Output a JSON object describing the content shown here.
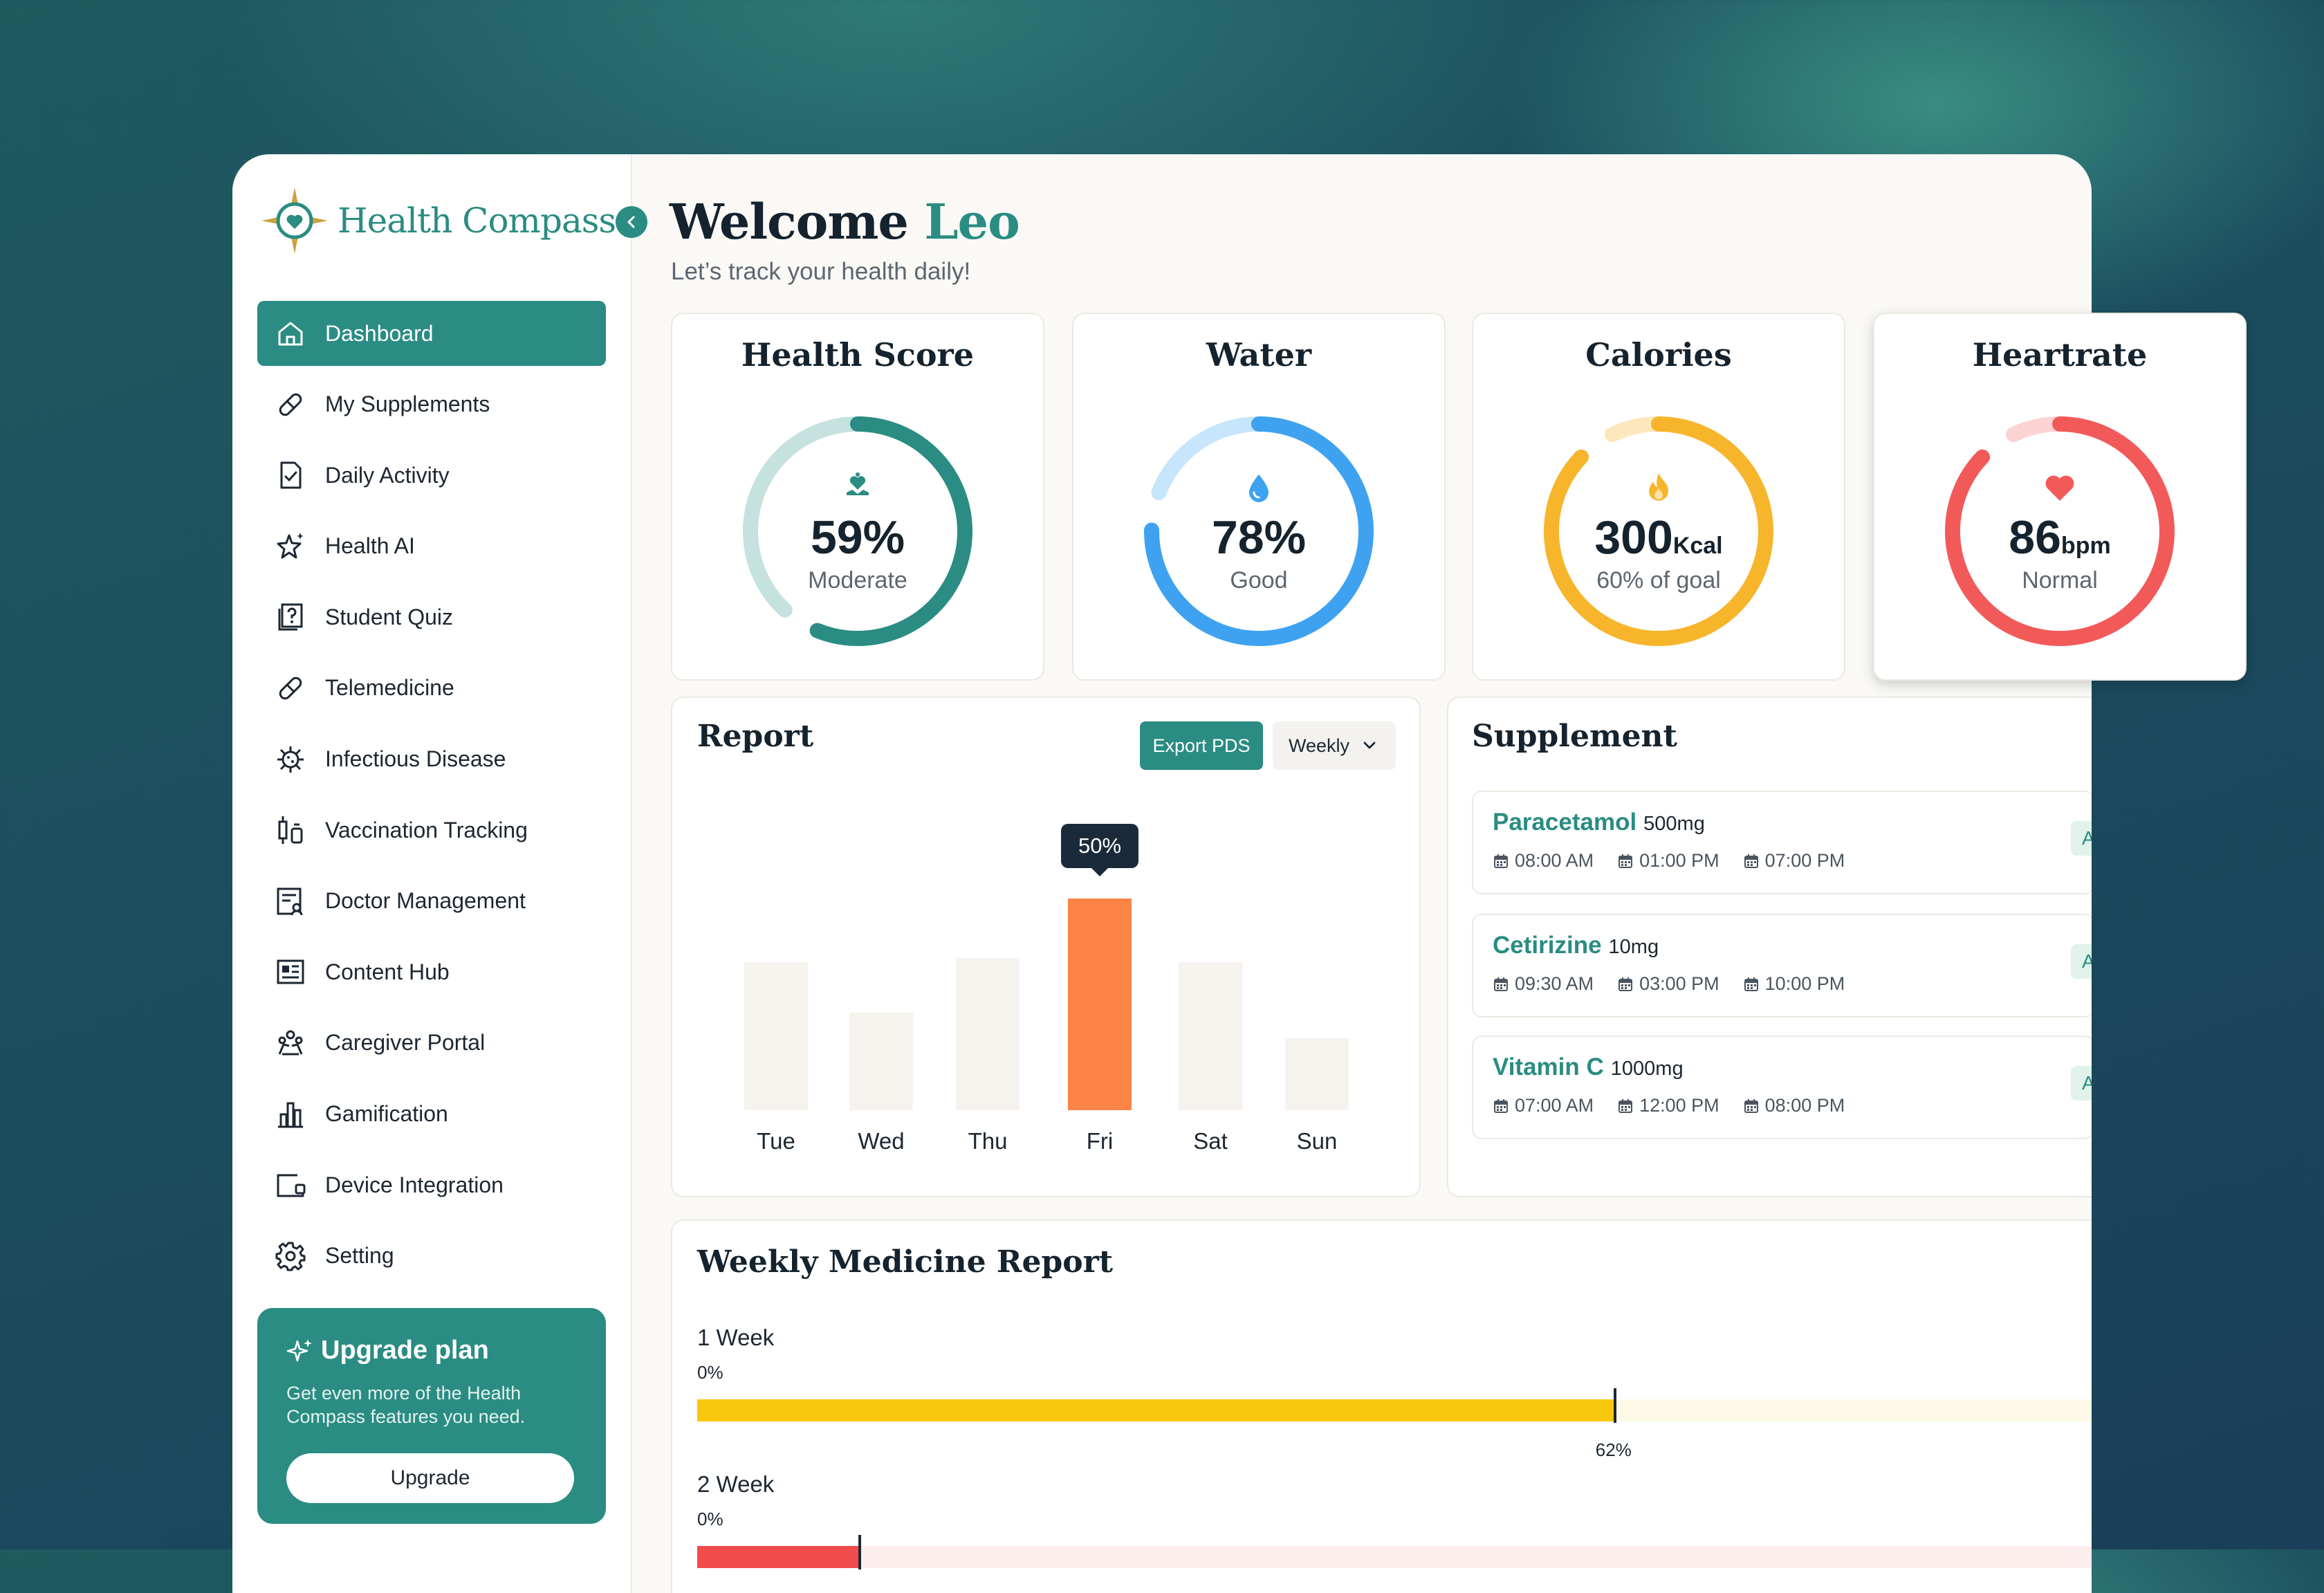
{
  "app": {
    "logo_text": "Health Compass",
    "accent_color": "#2a8c82"
  },
  "sidebar": {
    "items": [
      {
        "label": "Dashboard",
        "icon": "home-icon",
        "active": true
      },
      {
        "label": "My Supplements",
        "icon": "pill-icon"
      },
      {
        "label": "Daily Activity",
        "icon": "file-check-icon"
      },
      {
        "label": "Health AI",
        "icon": "sparkle-star-icon"
      },
      {
        "label": "Student Quiz",
        "icon": "quiz-icon"
      },
      {
        "label": "Telemedicine",
        "icon": "pill-icon"
      },
      {
        "label": "Infectious Disease",
        "icon": "virus-icon"
      },
      {
        "label": "Vaccination Tracking",
        "icon": "syringe-icon"
      },
      {
        "label": "Doctor Management",
        "icon": "doctor-list-icon"
      },
      {
        "label": "Content Hub",
        "icon": "newspaper-icon"
      },
      {
        "label": "Caregiver Portal",
        "icon": "caregiver-icon"
      },
      {
        "label": "Gamification",
        "icon": "bar-chart-icon"
      },
      {
        "label": "Device Integration",
        "icon": "device-icon"
      },
      {
        "label": "Setting",
        "icon": "gear-icon"
      }
    ],
    "upgrade": {
      "title": "Upgrade plan",
      "description": "Get even more of the Health Compass features you need.",
      "button": "Upgrade"
    }
  },
  "header": {
    "welcome": "Welcome",
    "name": "Leo",
    "subtitle": "Let’s track your health daily!"
  },
  "stats": [
    {
      "title": "Health Score",
      "value": "59%",
      "unit": "",
      "label": "Moderate",
      "progress": 0.59,
      "color": "#2a8c82",
      "track": "#c5e2df",
      "icon": "heart-hand-icon"
    },
    {
      "title": "Water",
      "value": "78%",
      "unit": "",
      "label": "Good",
      "progress": 0.78,
      "color": "#3ea2f0",
      "track": "#c7e5fb",
      "icon": "water-drop-icon"
    },
    {
      "title": "Calories",
      "value": "300",
      "unit": "Kcal",
      "label": "60% of goal",
      "progress": 0.9,
      "color": "#f7b52c",
      "track": "#fde8bd",
      "icon": "flame-icon"
    },
    {
      "title": "Heartrate",
      "value": "86",
      "unit": "bpm",
      "label": "Normal",
      "progress": 0.9,
      "color": "#f25a5a",
      "track": "#fcd3d3",
      "icon": "heart-icon"
    }
  ],
  "report": {
    "title": "Report",
    "export_label": "Export PDS",
    "period": "Weekly",
    "highlight_tooltip": "50%",
    "highlight_color": "#fb8446",
    "bar_color": "#f6f3ef"
  },
  "chart_data": {
    "type": "bar",
    "categories": [
      "Tue",
      "Wed",
      "Thu",
      "Fri",
      "Sat",
      "Sun"
    ],
    "values": [
      35,
      23,
      36,
      50,
      35,
      17
    ],
    "highlight_index": 3,
    "ylim": [
      0,
      50
    ]
  },
  "supplement": {
    "title": "Supplement",
    "items": [
      {
        "name": "Paracetamol",
        "dose": "500mg",
        "times": [
          "08:00 AM",
          "01:00 PM",
          "07:00 PM"
        ],
        "badge": "A"
      },
      {
        "name": "Cetirizine",
        "dose": "10mg",
        "times": [
          "09:30 AM",
          "03:00 PM",
          "10:00 PM"
        ],
        "badge": "A"
      },
      {
        "name": "Vitamin C",
        "dose": "1000mg",
        "times": [
          "07:00 AM",
          "12:00 PM",
          "08:00 PM"
        ],
        "badge": "A"
      }
    ]
  },
  "weekly_medicine": {
    "title": "Weekly Medicine Report",
    "weeks": [
      {
        "label": "1 Week",
        "start": "0%",
        "value_label": "62%",
        "value": 0.62,
        "color": "#f9c80e",
        "track": "#fef9e7"
      },
      {
        "label": "2 Week",
        "start": "0%",
        "value_label": "",
        "value": 0.11,
        "color": "#f14b4b",
        "track": "#fdeeee"
      }
    ]
  }
}
